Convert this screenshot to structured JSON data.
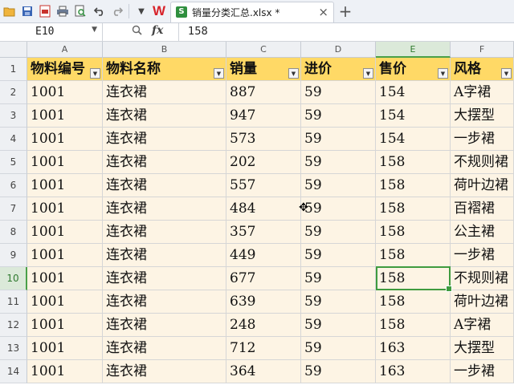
{
  "app": {
    "tab_title": "销量分类汇总.xlsx *",
    "logo_text": "W",
    "file_icon_letter": "S",
    "add_tab_label": "+",
    "close_tab_label": "×",
    "toolbar_icons": [
      "folder-open-icon",
      "save-icon",
      "export-pdf-icon",
      "print-icon",
      "print-preview-icon",
      "undo-icon",
      "redo-icon",
      "more-icon"
    ]
  },
  "formula_bar": {
    "cell_ref": "E10",
    "fx_label": "fx",
    "value": "158"
  },
  "sheet": {
    "column_letters": [
      "A",
      "B",
      "C",
      "D",
      "E",
      "F"
    ],
    "active_column": "E",
    "active_row": 10,
    "headers": [
      "物料编号",
      "物料名称",
      "销量",
      "进价",
      "售价",
      "风格"
    ],
    "row_numbers": [
      "1",
      "2",
      "3",
      "4",
      "5",
      "6",
      "7",
      "8",
      "9",
      "10",
      "11",
      "12",
      "13",
      "14"
    ],
    "rows": [
      [
        "1001",
        "连衣裙",
        "887",
        "59",
        "154",
        "A字裙"
      ],
      [
        "1001",
        "连衣裙",
        "947",
        "59",
        "154",
        "大摆型"
      ],
      [
        "1001",
        "连衣裙",
        "573",
        "59",
        "154",
        "一步裙"
      ],
      [
        "1001",
        "连衣裙",
        "202",
        "59",
        "158",
        "不规则裙"
      ],
      [
        "1001",
        "连衣裙",
        "557",
        "59",
        "158",
        "荷叶边裙"
      ],
      [
        "1001",
        "连衣裙",
        "484",
        "59",
        "158",
        "百褶裙"
      ],
      [
        "1001",
        "连衣裙",
        "357",
        "59",
        "158",
        "公主裙"
      ],
      [
        "1001",
        "连衣裙",
        "449",
        "59",
        "158",
        "一步裙"
      ],
      [
        "1001",
        "连衣裙",
        "677",
        "59",
        "158",
        "不规则裙"
      ],
      [
        "1001",
        "连衣裙",
        "639",
        "59",
        "158",
        "荷叶边裙"
      ],
      [
        "1001",
        "连衣裙",
        "248",
        "59",
        "158",
        "A字裙"
      ],
      [
        "1001",
        "连衣裙",
        "712",
        "59",
        "163",
        "大摆型"
      ],
      [
        "1001",
        "连衣裙",
        "364",
        "59",
        "163",
        "一步裙"
      ]
    ]
  },
  "colors": {
    "header_fill": "#ffd966",
    "cell_fill": "#fdf4e4",
    "selection": "#3f9b3f"
  }
}
